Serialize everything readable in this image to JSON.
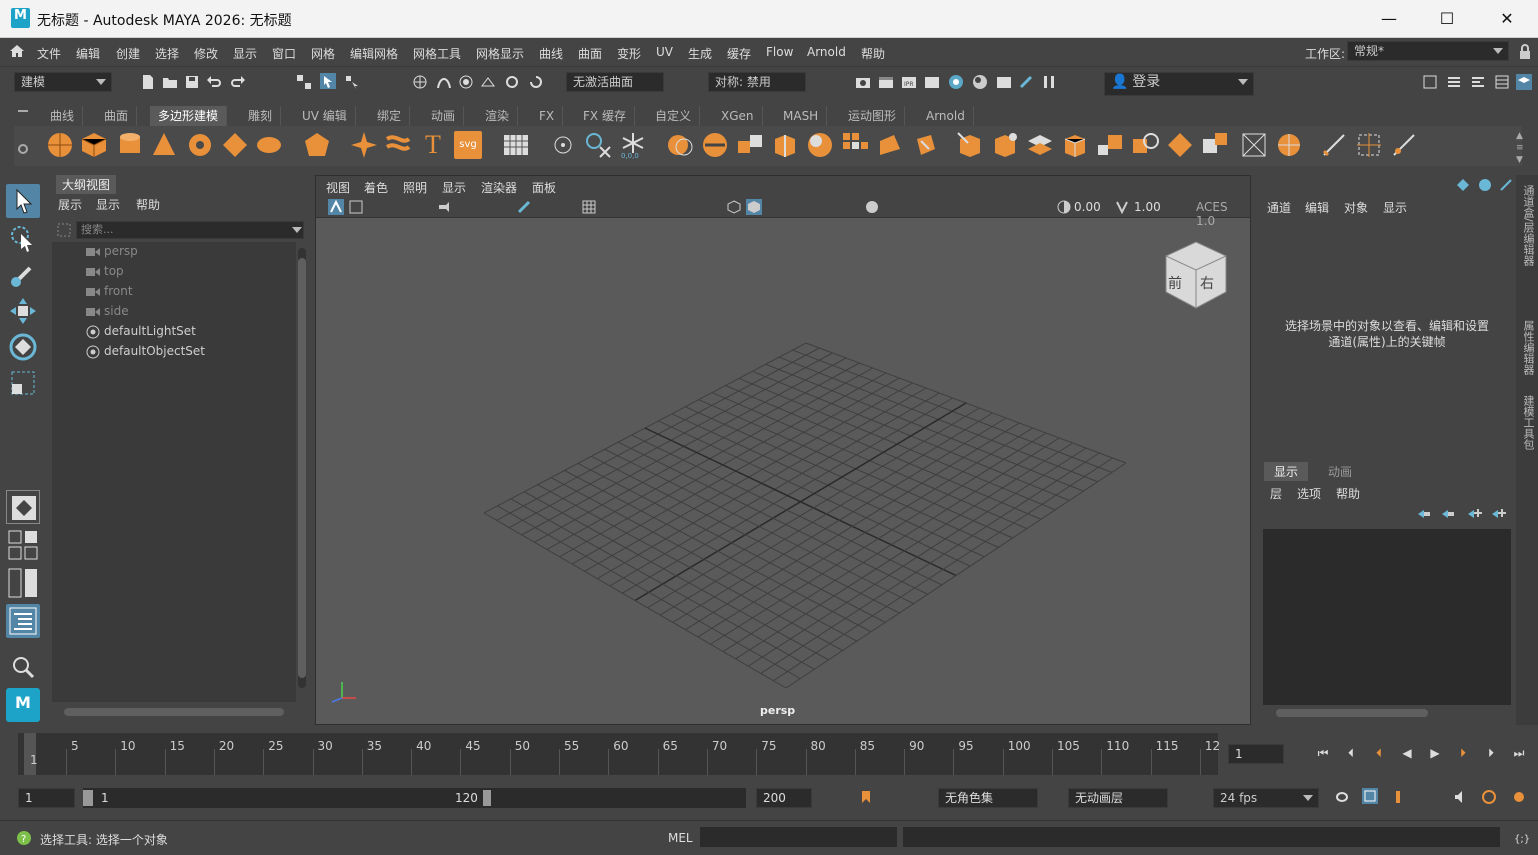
{
  "window": {
    "app_logo": "M",
    "title": "无标题 - Autodesk MAYA 2026: 无标题",
    "controls": [
      "—",
      "☐",
      "✕"
    ]
  },
  "menubar": {
    "items": [
      "文件",
      "编辑",
      "创建",
      "选择",
      "修改",
      "显示",
      "窗口",
      "网格",
      "编辑网格",
      "网格工具",
      "网格显示",
      "曲线",
      "曲面",
      "变形",
      "UV",
      "生成",
      "缓存",
      "Flow",
      "Arnold",
      "帮助"
    ],
    "workspace_label": "工作区:",
    "workspace_value": "常规*"
  },
  "statusline": {
    "mode": "建模",
    "live_surface": "无激活曲面",
    "symmetry": "对称: 禁用",
    "login": "登录"
  },
  "shelf": {
    "tabs": [
      "曲线",
      "曲面",
      "多边形建模",
      "雕刻",
      "UV 编辑",
      "绑定",
      "动画",
      "渲染",
      "FX",
      "FX 缓存",
      "自定义",
      "XGen",
      "MASH",
      "运动图形",
      "Arnold"
    ],
    "active_tab": "多边形建模",
    "text_tool_glyph": "T",
    "svg_tool_label": "svg"
  },
  "outliner": {
    "tab": "大纲视图",
    "menu": [
      "展示",
      "显示",
      "帮助"
    ],
    "search_placeholder": "搜索...",
    "items": [
      {
        "label": "persp",
        "dim": true
      },
      {
        "label": "top",
        "dim": true
      },
      {
        "label": "front",
        "dim": true
      },
      {
        "label": "side",
        "dim": true
      },
      {
        "label": "defaultLightSet",
        "dim": false
      },
      {
        "label": "defaultObjectSet",
        "dim": false
      }
    ]
  },
  "viewport": {
    "menu": [
      "视图",
      "着色",
      "照明",
      "显示",
      "渲染器",
      "面板"
    ],
    "exposure": "0.00",
    "gamma": "1.00",
    "color_space": "ACES 1.0",
    "camera_label": "persp",
    "viewcube_front": "前",
    "viewcube_right": "右"
  },
  "channel_box": {
    "menu": [
      "通道",
      "编辑",
      "对象",
      "显示"
    ],
    "hint": "选择场景中的对象以查看、编辑和设置通道(属性)上的关键帧"
  },
  "side_tabs": [
    "通道盒/层编辑器",
    "属性编辑器",
    "建模工具包"
  ],
  "layer_editor": {
    "tabs": [
      "显示",
      "动画"
    ],
    "active_tab": "显示",
    "menu": [
      "层",
      "选项",
      "帮助"
    ]
  },
  "timeline": {
    "ticks": [
      "5",
      "10",
      "15",
      "20",
      "25",
      "30",
      "35",
      "40",
      "45",
      "50",
      "55",
      "60",
      "65",
      "70",
      "75",
      "80",
      "85",
      "90",
      "95",
      "100",
      "105",
      "110",
      "115",
      "12"
    ],
    "current_frame_marker": "1",
    "current_frame": "1"
  },
  "range": {
    "start": "1",
    "range_start": "1",
    "range_end": "120",
    "end": "200",
    "character_set": "无角色集",
    "anim_layer": "无动画层",
    "fps": "24 fps"
  },
  "commandline": {
    "help_text": "选择工具: 选择一个对象",
    "lang": "MEL"
  },
  "colors": {
    "accent": "#5285a6",
    "shelf_orange": "#e8903a",
    "panel": "#444444",
    "field": "#2b2b2b"
  }
}
